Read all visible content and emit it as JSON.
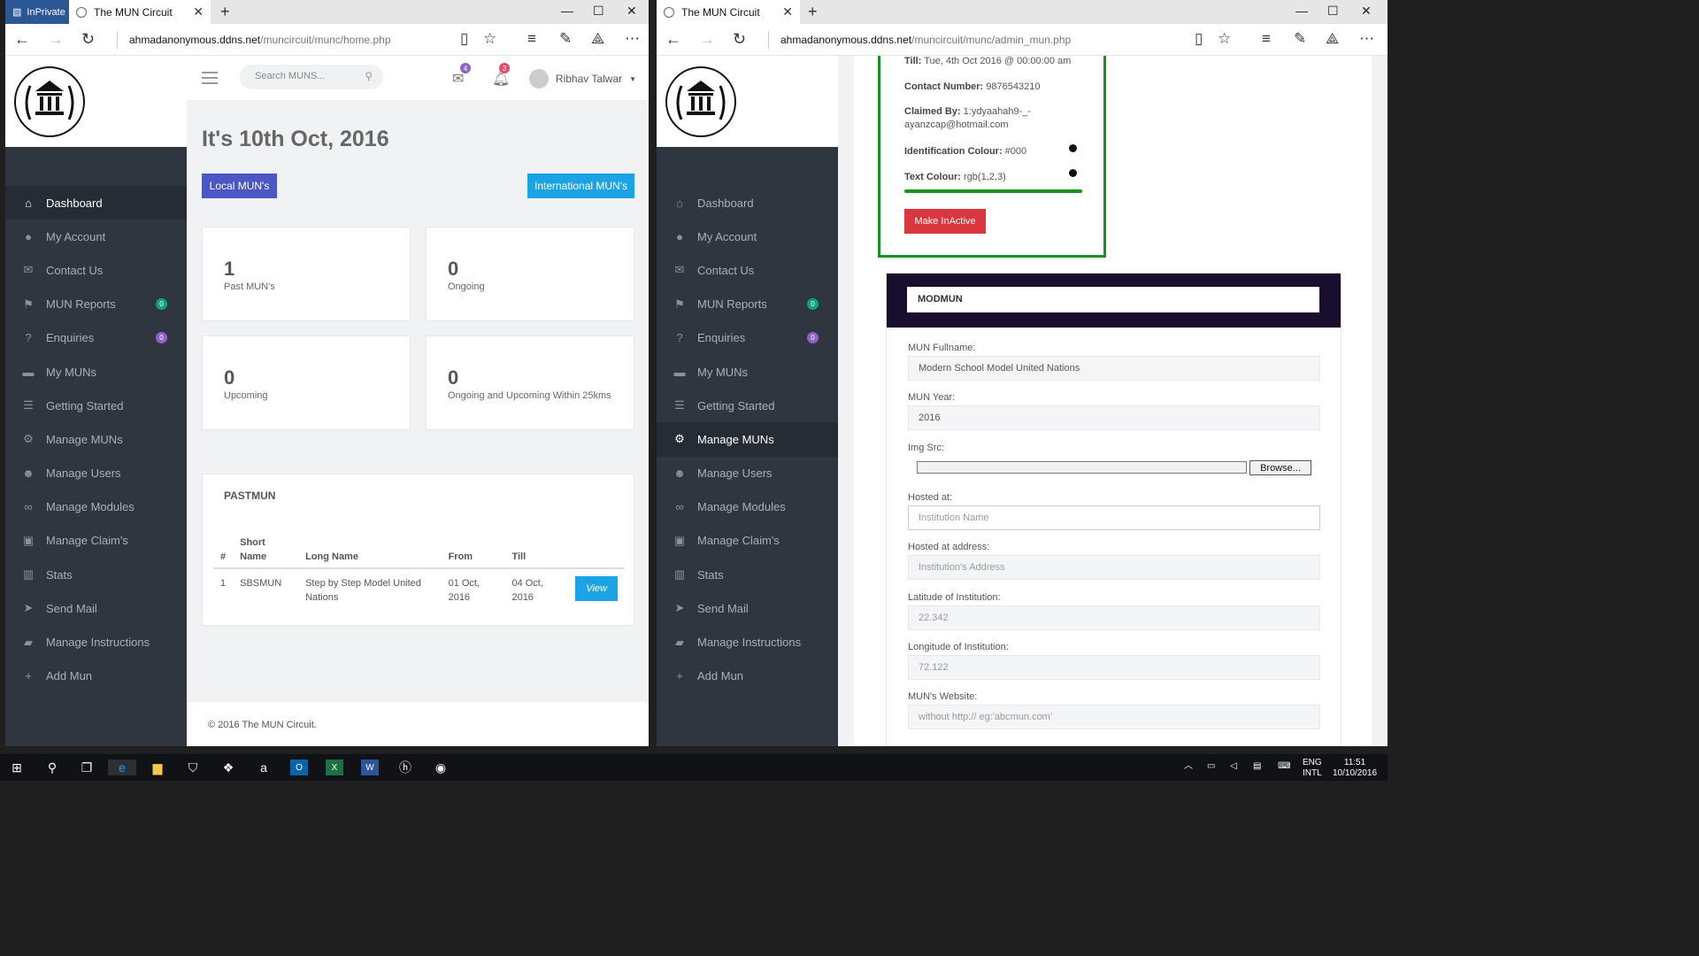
{
  "browser1": {
    "inprivate": "InPrivate",
    "tab_title": "The MUN Circuit",
    "url_host": "ahmadanonymous.ddns.net",
    "url_path": "/muncircuit/munc/home.php"
  },
  "browser2": {
    "tab_title": "The MUN Circuit",
    "url_host": "ahmadanonymous.ddns.net",
    "url_path": "/muncircuit/munc/admin_mun.php"
  },
  "sidebar": {
    "items": [
      {
        "label": "Dashboard",
        "icon": "home-icon"
      },
      {
        "label": "My Account",
        "icon": "user-icon"
      },
      {
        "label": "Contact Us",
        "icon": "envelope-icon"
      },
      {
        "label": "MUN Reports",
        "icon": "flag-icon",
        "badge": "0"
      },
      {
        "label": "Enquiries",
        "icon": "question-icon",
        "badge": "0"
      },
      {
        "label": "My MUNs",
        "icon": "briefcase-icon"
      },
      {
        "label": "Getting Started",
        "icon": "list-icon"
      },
      {
        "label": "Manage MUNs",
        "icon": "cogs-icon"
      },
      {
        "label": "Manage Users",
        "icon": "users-icon"
      },
      {
        "label": "Manage Modules",
        "icon": "link-icon"
      },
      {
        "label": "Manage Claim's",
        "icon": "box-icon"
      },
      {
        "label": "Stats",
        "icon": "bar-chart-icon"
      },
      {
        "label": "Send Mail",
        "icon": "send-icon"
      },
      {
        "label": "Manage Instructions",
        "icon": "book-icon"
      },
      {
        "label": "Add Mun",
        "icon": "plus-icon"
      }
    ],
    "badge_colors": {
      "reports": "#14a085",
      "enquiries": "#8e63c5"
    }
  },
  "header": {
    "search_placeholder": "Search MUNS...",
    "mail_count": "4",
    "notif_count": "3",
    "user_name": "Ribhav Talwar"
  },
  "dashboard": {
    "date_heading": "It's 10th Oct, 2016",
    "local_btn": "Local MUN's",
    "intl_btn": "International MUN's",
    "stats": [
      {
        "num": "1",
        "label": "Past MUN's"
      },
      {
        "num": "0",
        "label": "Ongoing"
      },
      {
        "num": "0",
        "label": "Upcoming"
      },
      {
        "num": "0",
        "label": "Ongoing and Upcoming Within 25kms"
      }
    ],
    "past_title": "PASTMUN",
    "table_headers": [
      "#",
      "Short Name",
      "Long Name",
      "From",
      "Till",
      ""
    ],
    "rows": [
      {
        "idx": "1",
        "short": "SBSMUN",
        "long": "Step by Step Model United Nations",
        "from": "01 Oct, 2016",
        "till": "04 Oct, 2016",
        "action": "View"
      }
    ],
    "footer": "© 2016 The MUN Circuit."
  },
  "admin": {
    "till_label": "Till:",
    "till_value": "Tue, 4th Oct 2016 @ 00:00:00 am",
    "contact_label": "Contact Number:",
    "contact_value": "9876543210",
    "claimed_label": "Claimed By:",
    "claimed_value_1": "1:ydyaahah9-_-",
    "claimed_value_2": "ayanzcap@hotmail.com",
    "idcolour_label": "Identification Colour:",
    "idcolour_value": "#000",
    "textcolour_label": "Text Colour:",
    "textcolour_value": "rgb(1,2,3)",
    "inactive_btn": "Make InActive",
    "form_title": "MODMUN",
    "fields": [
      {
        "label": "MUN Fullname:",
        "value": "Modern School Model United Nations"
      },
      {
        "label": "MUN Year:",
        "value": "2016"
      },
      {
        "label": "Img Src:",
        "value": ""
      },
      {
        "label": "Hosted at:",
        "placeholder": "Institution Name"
      },
      {
        "label": "Hosted at address:",
        "placeholder": "Institution's Address"
      },
      {
        "label": "Latitude of Institution:",
        "value": "22.342"
      },
      {
        "label": "Longitude of Institution:",
        "value": "72.122"
      },
      {
        "label": "MUN's Website:",
        "placeholder": "without http:// eg:'abcmun.com'"
      }
    ],
    "browse_btn": "Browse..."
  },
  "taskbar": {
    "lang1": "ENG",
    "lang2": "INTL",
    "time": "11:51",
    "date": "10/10/2016"
  },
  "colors": {
    "sidebar": "#2f3640",
    "primary_btn": "#4a57c4",
    "info_btn": "#1ca3e6",
    "danger": "#d9363e",
    "success": "#19931f"
  }
}
